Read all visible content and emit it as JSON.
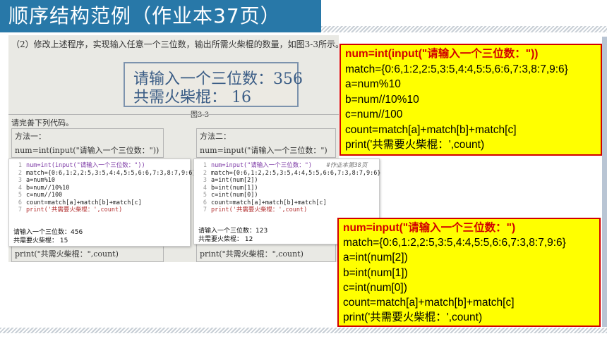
{
  "title": "顺序结构范例（作业本37页）",
  "book": {
    "task": "（2）修改上述程序，实现输入任意一个三位数，输出所需火柴棍的数量，如图3-3所示。",
    "fig_line1": "请输入一个三位数：356",
    "fig_line2": "共需火柴棍：  16",
    "fig_caption": "图3-3",
    "instruction": "请完善下列代码。",
    "method1_label": "方法一：",
    "method1_code": "num=int(input(\"请输入一个三位数：\"))",
    "method2_label": "方法二：",
    "method2_code": "num=input(\"请输入一个三位数：\")",
    "method1_tail": "print(\"共需火柴棍：\",count)",
    "method2_tail": "print(\"共需火柴棍：\",count)"
  },
  "pane1": {
    "lines": [
      "num=int(input(\"请输入一个三位数：\"))",
      "match={0:6,1:2,2:5,3:5,4:4,5:5,6:6,7:3,8:7,9:6}",
      "a=num%10",
      "b=num//10%10",
      "c=num//100",
      "count=match[a]+match[b]+match[c]",
      "print('共需要火柴棍：',count)"
    ],
    "out1": "请输入一个三位数：456",
    "out2": "共需要火柴棍：  15"
  },
  "pane2": {
    "comment": "#作业本第38页",
    "lines": [
      "num=input(\"请输入一个三位数：\")",
      "match={0:6,1:2,2:5,3:5,4:4,5:5,6:6,7:3,8:7,9:6}",
      "a=int(num[2])",
      "b=int(num[1])",
      "c=int(num[0])",
      "count=match[a]+match[b]+match[c]",
      "print('共需要火柴棍：',count)"
    ],
    "out1": "请输入一个三位数：123",
    "out2": "共需要火柴棍：  12"
  },
  "box1": {
    "lines": [
      "num=int(input(\"请输入一个三位数：\"))",
      "match={0:6,1:2,2:5,3:5,4:4,5:5,6:6,7:3,8:7,9:6}",
      "a=num%10",
      "b=num//10%10",
      "c=num//100",
      "count=match[a]+match[b]+match[c]",
      "print('共需要火柴棍：',count)"
    ]
  },
  "box2": {
    "lines": [
      "num=input(\"请输入一个三位数：\")",
      "match={0:6,1:2,2:5,3:5,4:4,5:5,6:6,7:3,8:7,9:6}",
      "a=int(num[2])",
      "b=int(num[1])",
      "c=int(num[0])",
      "count=match[a]+match[b]+match[c]",
      "print('共需要火柴棍：',count)"
    ]
  },
  "colors": {
    "title_bg": "#2878a8",
    "highlight_bg": "#ffff00",
    "highlight_border": "#d10000"
  }
}
